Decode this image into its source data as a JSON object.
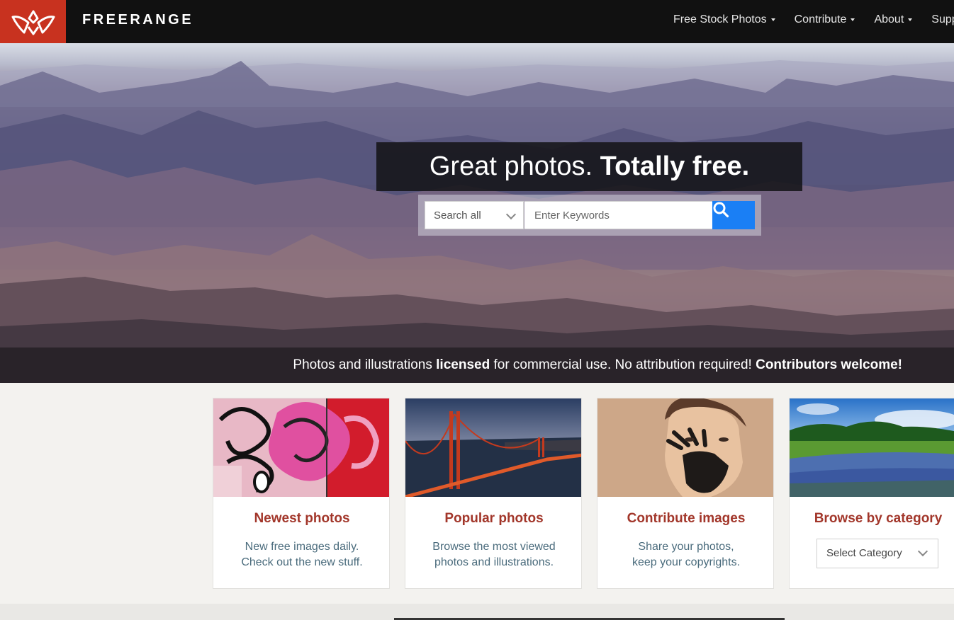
{
  "brand": {
    "name": "FREERANGE",
    "logo_icon": "wings-logo-icon"
  },
  "colors": {
    "brand_red": "#c8321f",
    "accent_blue": "#1a7ff5",
    "title_red": "#a2362a",
    "nav_bg": "#111111"
  },
  "nav": {
    "items": [
      {
        "label": "Free Stock Photos"
      },
      {
        "label": "Contribute"
      },
      {
        "label": "About"
      },
      {
        "label": "Support"
      }
    ]
  },
  "hero": {
    "headline_light": "Great photos. ",
    "headline_bold": "Totally free.",
    "search": {
      "scope": "Search all",
      "placeholder": "Enter Keywords",
      "button_icon": "search-icon"
    },
    "tagline": {
      "part1": "Photos and illustrations ",
      "bold1": "licensed",
      "part2": " for commercial use. No attribution required! ",
      "bold2": "Contributors welcome!"
    }
  },
  "cards": [
    {
      "title": "Newest photos",
      "line1": "New free images daily.",
      "line2": "Check out the new stuff.",
      "image": "graffiti-photo"
    },
    {
      "title": "Popular photos",
      "line1": "Browse the most viewed",
      "line2": "photos and illustrations.",
      "image": "golden-gate-bridge-photo"
    },
    {
      "title": "Contribute images",
      "line1": "Share your photos,",
      "line2": "keep your copyrights.",
      "image": "painted-face-photo"
    },
    {
      "title": "Browse by category",
      "select": "Select Category",
      "image": "bluebonnet-field-photo"
    }
  ]
}
